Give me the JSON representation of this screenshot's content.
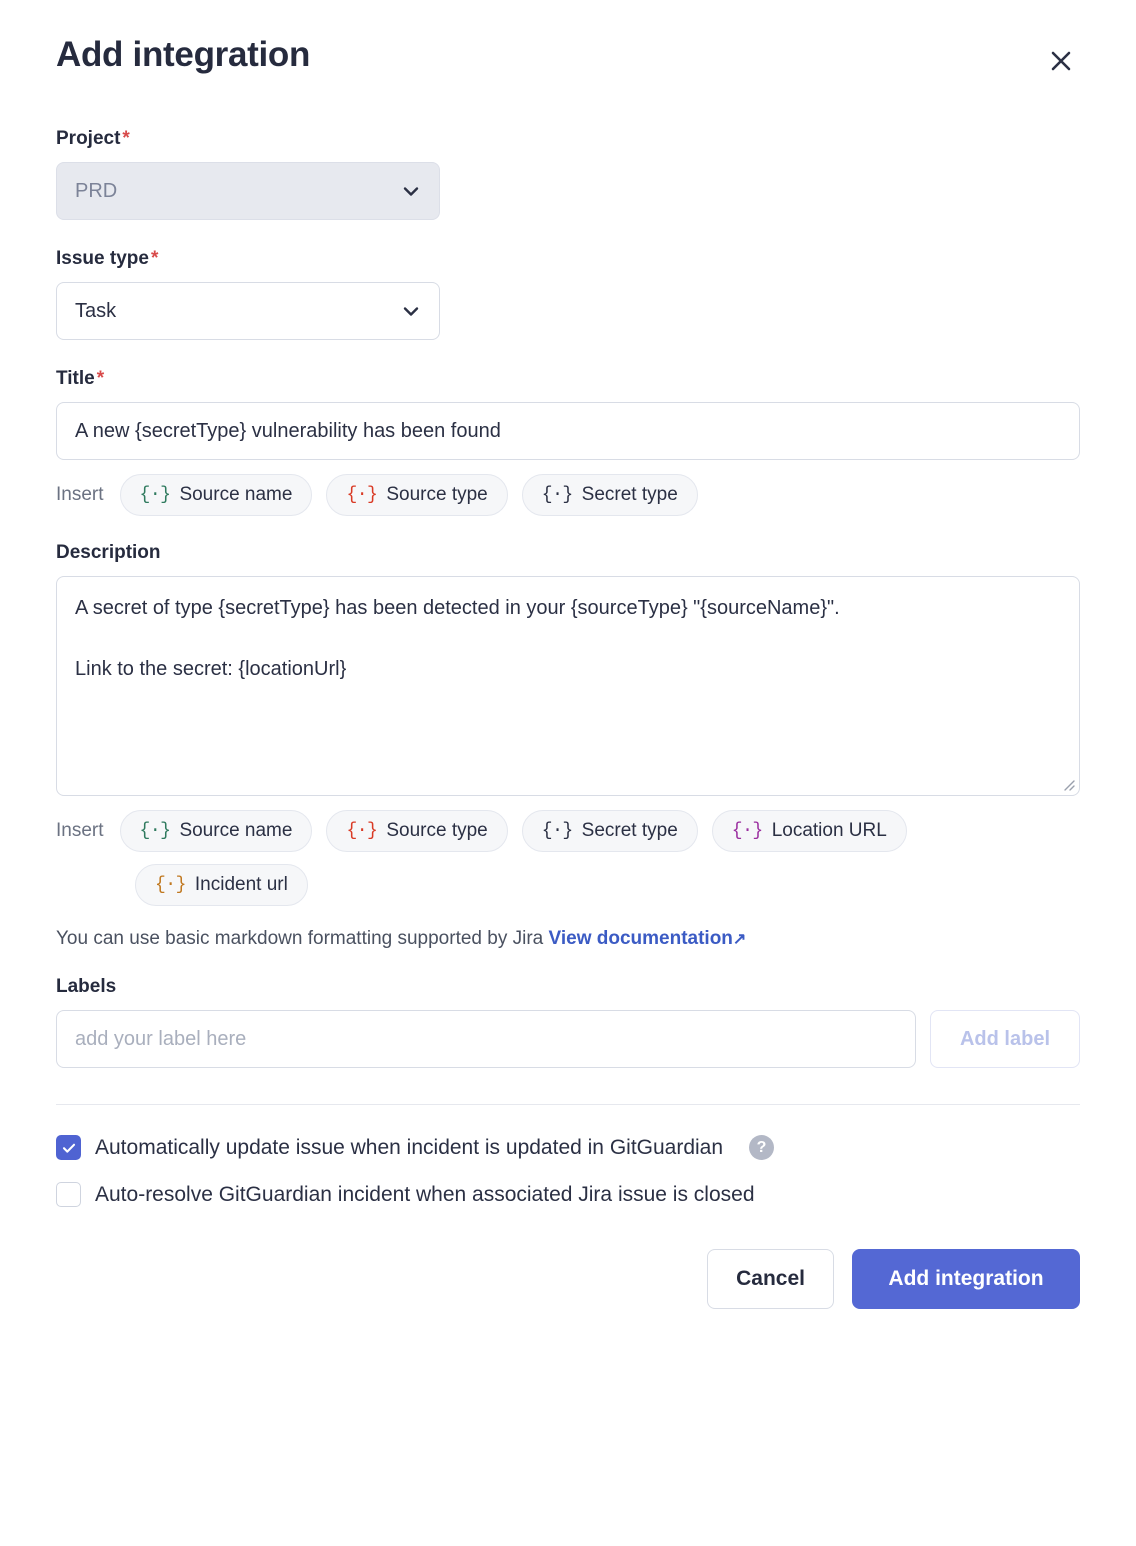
{
  "modal": {
    "title": "Add integration",
    "close_icon": "close-icon"
  },
  "project": {
    "label": "Project",
    "required_mark": "*",
    "value": "PRD",
    "disabled": true
  },
  "issue_type": {
    "label": "Issue type",
    "required_mark": "*",
    "value": "Task",
    "disabled": false
  },
  "title_field": {
    "label": "Title",
    "required_mark": "*",
    "value": "A new {secretType} vulnerability has been found",
    "insert_label": "Insert",
    "chips": [
      {
        "glyph": "{·}",
        "label": "Source name",
        "color": "#2f7a5e"
      },
      {
        "glyph": "{·}",
        "label": "Source type",
        "color": "#d93a25"
      },
      {
        "glyph": "{·}",
        "label": "Secret type",
        "color": "#2b3044"
      }
    ]
  },
  "description_field": {
    "label": "Description",
    "value": "A secret of type {secretType} has been detected in your {sourceType} \"{sourceName}\".\n\nLink to the secret: {locationUrl}",
    "insert_label": "Insert",
    "chips": [
      {
        "glyph": "{·}",
        "label": "Source name",
        "color": "#2f7a5e"
      },
      {
        "glyph": "{·}",
        "label": "Source type",
        "color": "#d93a25"
      },
      {
        "glyph": "{·}",
        "label": "Secret type",
        "color": "#2b3044"
      },
      {
        "glyph": "{·}",
        "label": "Location URL",
        "color": "#9b2fa0"
      },
      {
        "glyph": "{·}",
        "label": "Incident url",
        "color": "#c07820"
      }
    ],
    "markdown_note": "You can use basic markdown formatting supported by Jira",
    "doc_link_text": "View documentation",
    "doc_link_arrow": "↗"
  },
  "labels_field": {
    "label": "Labels",
    "placeholder": "add your label here",
    "value": "",
    "add_button": "Add label",
    "add_button_disabled": true
  },
  "options": [
    {
      "label": "Automatically update issue when incident is updated in GitGuardian",
      "checked": true,
      "has_help": true,
      "help_glyph": "?"
    },
    {
      "label": "Auto-resolve GitGuardian incident when associated Jira issue is closed",
      "checked": false,
      "has_help": false
    }
  ],
  "footer": {
    "cancel_label": "Cancel",
    "submit_label": "Add integration"
  },
  "colors": {
    "primary": "#5468d4",
    "required": "#d84a4a",
    "link": "#3b5bc4",
    "text": "#2b3044",
    "disabled_bg": "#e7e9ef"
  }
}
